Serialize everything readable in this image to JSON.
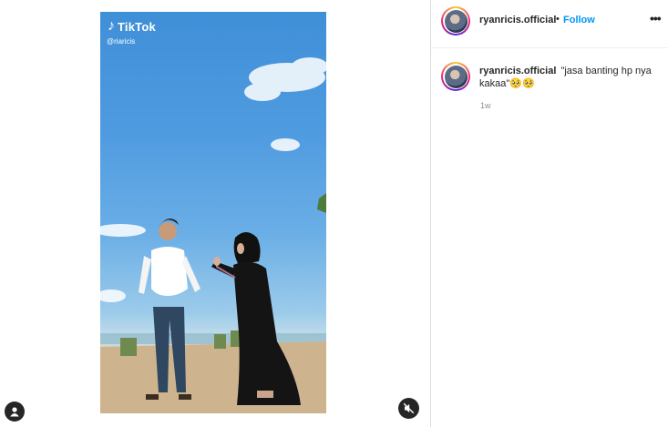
{
  "video": {
    "watermark_brand": "TikTok",
    "watermark_handle": "@riaricis"
  },
  "post": {
    "username": "ryanricis.official",
    "separator": "•",
    "follow_label": "Follow",
    "more_label": "•••",
    "caption": {
      "username": "ryanricis.official",
      "text": "\"jasa banting hp nya kakaa\"🥺🥺",
      "time": "1w"
    }
  },
  "icons": {
    "user_tag": "user-tag-icon",
    "mute": "mute-icon",
    "more": "more-options-icon",
    "tiktok": "tiktok-note-icon"
  },
  "colors": {
    "follow_blue": "#0095f6",
    "text_primary": "#262626",
    "text_secondary": "#8e8e8e",
    "border": "#dbdbdb"
  }
}
